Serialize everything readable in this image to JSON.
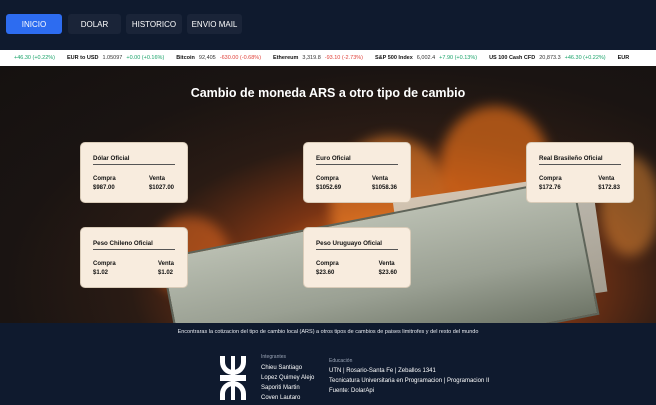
{
  "nav": {
    "buttons": [
      {
        "label": "INICIO",
        "active": true
      },
      {
        "label": "DOLAR",
        "active": false
      },
      {
        "label": "HISTORICO",
        "active": false
      },
      {
        "label": "ENVIO MAIL",
        "active": false
      }
    ]
  },
  "ticker": {
    "items": [
      {
        "name": "",
        "price": "",
        "change": "+46.30 (+0.22%)",
        "direction": "up"
      },
      {
        "name": "EUR to USD",
        "price": "1.05097",
        "change": "+0.00 (+0.16%)",
        "direction": "up"
      },
      {
        "name": "Bitcoin",
        "price": "92,405",
        "change": "-630.00 (-0.68%)",
        "direction": "down"
      },
      {
        "name": "Ethereum",
        "price": "3,319.8",
        "change": "-93.10 (-2.73%)",
        "direction": "down"
      },
      {
        "name": "S&P 500 Index",
        "price": "6,002.4",
        "change": "+7.90 (+0.13%)",
        "direction": "up"
      },
      {
        "name": "US 100 Cash CFD",
        "price": "20,873.3",
        "change": "+46.30 (+0.22%)",
        "direction": "up"
      },
      {
        "name": "EUR",
        "price": "",
        "change": "",
        "direction": "up"
      }
    ]
  },
  "hero": {
    "title": "Cambio de moneda ARS a otro tipo de cambio"
  },
  "cards": [
    {
      "title": "Dólar Oficial",
      "compra_label": "Compra",
      "venta_label": "Venta",
      "compra": "$987.00",
      "venta": "$1027.00"
    },
    {
      "title": "Euro Oficial",
      "compra_label": "Compra",
      "venta_label": "Venta",
      "compra": "$1052.69",
      "venta": "$1058.36"
    },
    {
      "title": "Real Brasileño Oficial",
      "compra_label": "Compra",
      "venta_label": "Venta",
      "compra": "$172.76",
      "venta": "$172.83"
    },
    {
      "title": "Peso Chileno Oficial",
      "compra_label": "Compra",
      "venta_label": "Venta",
      "compra": "$1.02",
      "venta": "$1.02"
    },
    {
      "title": "Peso Uruguayo Oficial",
      "compra_label": "Compra",
      "venta_label": "Venta",
      "compra": "$23.60",
      "venta": "$23.60"
    }
  ],
  "footer": {
    "description": "Encontraras la cotizacion del tipo de cambio local (ARS) a otros tipos de cambios de paises limitrofes y del resto del mundo",
    "integrantes_title": "Integrantes",
    "integrantes": [
      "Chieu Santiago",
      "Lopez Quimey Alejo",
      "Saporiti Martin",
      "Coven Lautaro"
    ],
    "educacion_title": "Educación",
    "educacion": [
      "UTN | Rosario-Santa Fe | Zeballos 1341",
      "Tecnicatura Universitaria en Programacion | Programacion II",
      "Fuente: DolarApi"
    ]
  },
  "colors": {
    "active_button": "#2d6cf0",
    "background": "#0f1a2e",
    "card": "#f8ecde",
    "up": "#1aa36a",
    "down": "#e0413a"
  }
}
